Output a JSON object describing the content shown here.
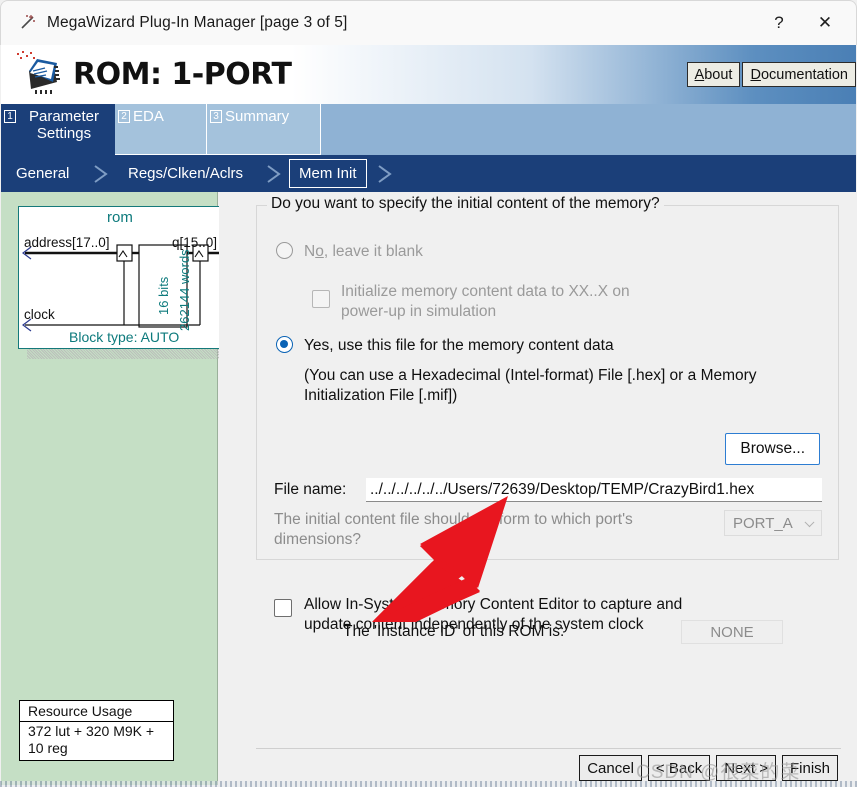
{
  "window": {
    "title": "MegaWizard Plug-In Manager [page 3 of 5]",
    "icon": "wand-icon",
    "help_label": "?",
    "close_label": "✕"
  },
  "banner": {
    "title": "ROM: 1-PORT",
    "logo": "megawizard-chip-logo",
    "about_accel": "A",
    "about_rest": "bout",
    "doc_accel": "D",
    "doc_rest": "ocumentation",
    "about_label": "About",
    "doc_label": "Documentation"
  },
  "tabs": [
    {
      "num": "1",
      "label": "Parameter Settings",
      "active": true
    },
    {
      "num": "2",
      "label": "EDA",
      "active": false
    },
    {
      "num": "3",
      "label": "Summary",
      "active": false
    }
  ],
  "subnav": [
    {
      "label": "General",
      "selected": false
    },
    {
      "label": "Regs/Clken/Aclrs",
      "selected": false
    },
    {
      "label": "Mem Init",
      "selected": true
    }
  ],
  "preview": {
    "instance_name": "rom",
    "port_address": "address[17..0]",
    "port_q": "q[15..0]",
    "port_clock": "clock",
    "depth_label": "16 bits",
    "width_label": "262144 words",
    "block_type": "Block type: AUTO"
  },
  "resource_usage": {
    "title": "Resource Usage",
    "value": "372 lut + 320 M9K + 10 reg"
  },
  "main": {
    "group_legend": "Do you want to specify the initial content of the memory?",
    "option_no_prefix": "N",
    "option_no_accel": "o",
    "option_no_rest": ", leave it blank",
    "option_no_label": "No, leave it blank",
    "checkbox_xx_line1": "Initialize memory content data to XX..X on",
    "checkbox_xx_line2": "power-up in simulation",
    "option_yes_label": "Yes, use this file for the memory content data",
    "hint_line1": "(You can use a Hexadecimal (Intel-format) File [.hex] or a Memory",
    "hint_line2": "Initialization File [.mif])",
    "browse_label": "Browse...",
    "file_name_label": "File name:",
    "file_name_value": "../../../../../../Users/72639/Desktop/TEMP/CrazyBird1.hex",
    "file_name_placeholder": "",
    "port_question_line1": "The initial content file should conform to which port's",
    "port_question_line2": "dimensions?",
    "port_select_value": "PORT_A",
    "ise_line1": "Allow In-System Memory Content Editor to capture and",
    "ise_line2": "update content independently of the system clock",
    "instance_id_label": "The 'Instance ID' of this ROM is:",
    "instance_id_value": "NONE"
  },
  "footer": {
    "cancel": "Cancel",
    "back": "< Back",
    "next": "Next >",
    "finish": "Finish"
  },
  "annotation": {
    "arrow": "red-arrow-pointing-up-right",
    "arrow_color": "#e8161f",
    "watermark": "CSDN @很菜的菜"
  },
  "colors": {
    "banner_blue": "#4a7fb5",
    "tab_active": "#1b3f79",
    "tab_inactive": "#a4c2dc",
    "tabstrip": "#8fb2d4",
    "preview_bg": "#c5dfc5",
    "accent_blue": "#0a63b5",
    "teal": "#0d7a7c",
    "content_bg": "#f0f0f0"
  }
}
